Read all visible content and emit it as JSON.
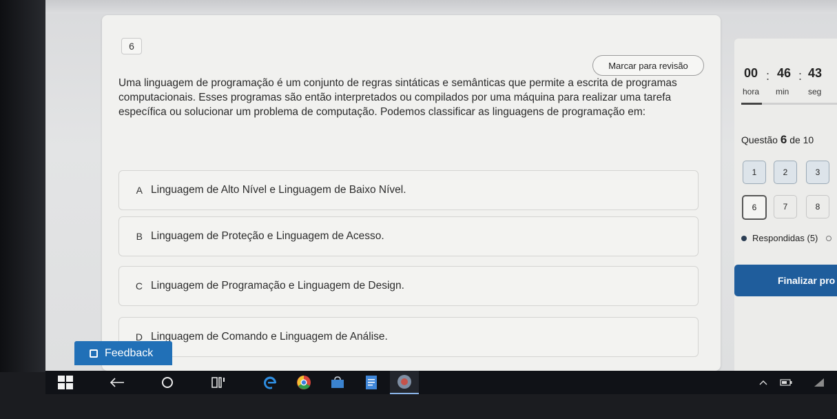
{
  "question": {
    "number": "6",
    "review_label": "Marcar para revisão",
    "text": "Uma linguagem de programação é um conjunto de regras sintáticas e semânticas que permite a escrita de programas computacionais. Esses programas são então interpretados ou compilados por uma máquina para realizar uma tarefa específica ou solucionar um problema de computação. Podemos classificar as linguagens de programação em:",
    "options": [
      {
        "letter": "A",
        "text": "Linguagem de Alto Nível e Linguagem de Baixo Nível."
      },
      {
        "letter": "B",
        "text": "Linguagem de Proteção e Linguagem de Acesso."
      },
      {
        "letter": "C",
        "text": "Linguagem de Programação e Linguagem de Design."
      },
      {
        "letter": "D",
        "text": "Linguagem de Comando e Linguagem de Análise."
      }
    ]
  },
  "timer": {
    "hours": "00",
    "minutes": "46",
    "seconds": "43",
    "sep": ":",
    "hours_label": "hora",
    "minutes_label": "min",
    "seconds_label": "seg"
  },
  "progress": {
    "prefix": "Questão",
    "current": "6",
    "suffix": "de 10",
    "buttons": [
      "1",
      "2",
      "3",
      "6",
      "7",
      "8"
    ],
    "answered_label": "Respondidas (5)",
    "finalize_label": "Finalizar pro"
  },
  "feedback_label": "Feedback",
  "icons": {
    "feedback": "feedback-icon",
    "start": "windows-start-icon",
    "back": "back-arrow-icon",
    "search": "search-circle-icon",
    "task_view": "task-view-icon",
    "edge": "edge-browser-icon",
    "chrome": "chrome-icon",
    "store": "store-icon",
    "notes": "notes-icon",
    "app": "app-icon",
    "tray_up": "chevron-up-icon"
  }
}
